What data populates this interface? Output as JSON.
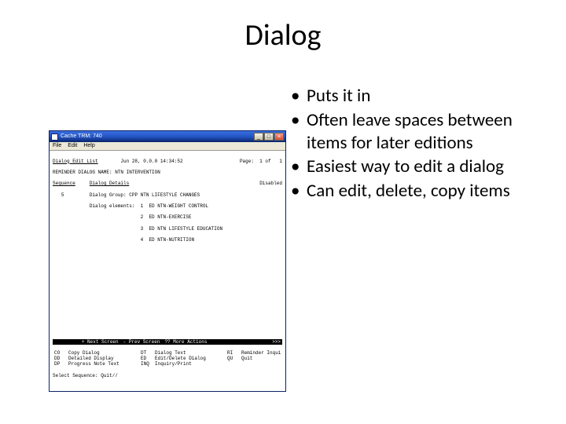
{
  "title": "Dialog",
  "bullets": [
    "Puts it in",
    "Often leave spaces between items for later editions",
    "Easiest way to edit a dialog",
    "Can edit, delete, copy items"
  ],
  "window": {
    "title": "Cache TRM: 740",
    "menu": [
      "File",
      "Edit",
      "Help"
    ],
    "header": {
      "left": "Dialog Edit List",
      "center": "Jun 28, 0.0.0 14:34:52",
      "page_label": "Page:",
      "page_value": "1 of",
      "page_total": "1"
    },
    "subheader": "REMINDER DIALOG NAME: NTN INTERVENTION",
    "columns": {
      "left": "Sequence",
      "right": "Dialog Details",
      "status": "Disabled"
    },
    "group_row": {
      "seq": "5",
      "text": "Dialog Group: CPP NTN LIFESTYLE CHANGES"
    },
    "elements_label": "Dialog elements:",
    "elements": [
      {
        "n": "1",
        "text": "ED NTN-WEIGHT CONTROL"
      },
      {
        "n": "2",
        "text": "ED NTN-EXERCISE"
      },
      {
        "n": "3",
        "text": "ED NTN LIFESTYLE EDUCATION"
      },
      {
        "n": "4",
        "text": "ED NTN-NUTRITION"
      }
    ],
    "nav_bar": {
      "next": "+ Next Screen",
      "prev": "- Prev Screen",
      "more": "?? More Actions",
      "arrow": ">>>"
    },
    "commands": [
      {
        "k": "CO",
        "v": "Copy Dialog"
      },
      {
        "k": "DT",
        "v": "Dialog Text"
      },
      {
        "k": "RI",
        "v": "Reminder Inquiry"
      },
      {
        "k": "DD",
        "v": "Detailed Display"
      },
      {
        "k": "ED",
        "v": "Edit/Delete Dialog"
      },
      {
        "k": "QU",
        "v": "Quit"
      },
      {
        "k": "DP",
        "v": "Progress Note Text"
      },
      {
        "k": "INQ",
        "v": "Inquiry/Print"
      },
      {
        "k": "",
        "v": ""
      }
    ],
    "prompt": "Select Sequence: Quit//"
  }
}
